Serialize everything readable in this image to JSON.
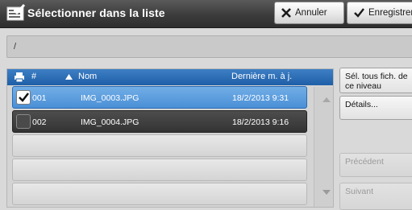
{
  "title": "Sélectionner dans la liste",
  "toolbar": {
    "cancel_label": "Annuler",
    "save_label": "Enregistrer"
  },
  "path": "/",
  "list": {
    "headers": {
      "number": "#",
      "name": "Nom",
      "modified": "Dernière m. à j."
    },
    "rows": [
      {
        "number": "001",
        "name": "IMG_0003.JPG",
        "modified": "18/2/2013 9:31",
        "checked": true
      },
      {
        "number": "002",
        "name": "IMG_0004.JPG",
        "modified": "18/2/2013 9:16",
        "checked": false
      }
    ]
  },
  "side": {
    "select_all": "Sél. tous fich. de ce niveau",
    "details": "Détails...",
    "previous": "Précédent",
    "next": "Suivant"
  },
  "colors": {
    "selected_row": "#4a8fd6",
    "header": "#2a6db5",
    "titlebar": "#3c3c3c"
  }
}
